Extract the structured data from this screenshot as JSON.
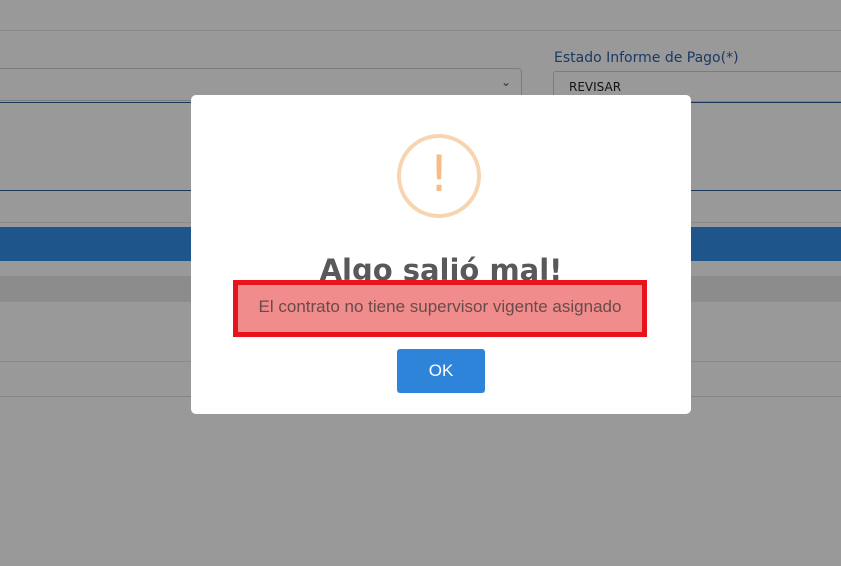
{
  "form": {
    "status_label": "Estado Informe de Pago(*)",
    "status_value": "REVISAR"
  },
  "dialog": {
    "icon_glyph": "!",
    "icon_name": "warning-icon",
    "title": "Algo salió mal!",
    "message": "El contrato no tiene supervisor vigente asignado",
    "ok_label": "OK"
  },
  "colors": {
    "accent": "#3390e8",
    "button": "#2e84d8",
    "warning": "#f8bb86",
    "highlight_border": "#e8141c",
    "highlight_fill": "#f08c8c"
  }
}
